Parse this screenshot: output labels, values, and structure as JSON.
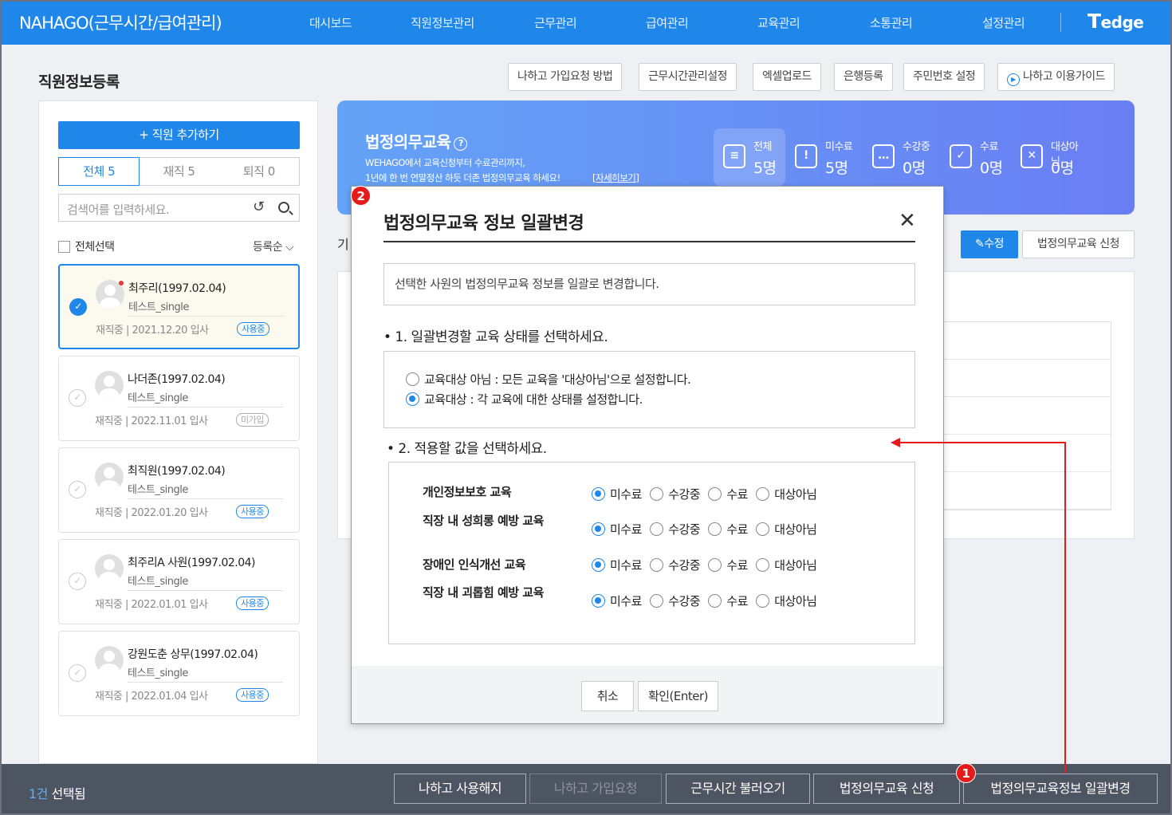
{
  "header": {
    "brand": "NAHAGO(근무시간/급여관리)",
    "nav": [
      "대시보드",
      "직원정보관리",
      "근무관리",
      "급여관리",
      "교육관리",
      "소통관리",
      "설정관리"
    ],
    "logo_t": "T",
    "logo_text": "edge"
  },
  "page": {
    "title": "직원정보등록",
    "toolbar": [
      "나하고 가입요청 방법",
      "근무시간관리설정",
      "엑셀업로드",
      "은행등록",
      "주민번호 설정"
    ],
    "guide": "나하고 이용가이드"
  },
  "left": {
    "add_button": "+ 직원 추가하기",
    "tabs": [
      "전체 5",
      "재직 5",
      "퇴직 0"
    ],
    "search_placeholder": "검색어를 입력하세요.",
    "select_all": "전체선택",
    "sort": "등록순",
    "employees": [
      {
        "name": "최주리(1997.02.04)",
        "team": "테스트_single",
        "info": "재직중 | 2021.12.20 입사",
        "badge": "사용중"
      },
      {
        "name": "나더존(1997.02.04)",
        "team": "테스트_single",
        "info": "재직중 | 2022.11.01 입사",
        "badge": "미가입"
      },
      {
        "name": "최직원(1997.02.04)",
        "team": "테스트_single",
        "info": "재직중 | 2022.01.20 입사",
        "badge": "사용중"
      },
      {
        "name": "최주리A 사원(1997.02.04)",
        "team": "테스트_single",
        "info": "재직중 | 2022.01.01 입사",
        "badge": "사용중"
      },
      {
        "name": "강원도춘 상무(1997.02.04)",
        "team": "테스트_single",
        "info": "재직중 | 2022.01.04 입사",
        "badge": "사용중"
      }
    ]
  },
  "banner": {
    "title": "법정의무교육",
    "desc1": "WEHAGO에서 교육신청부터 수료관리까지,",
    "desc2": "1년에 한 번 연말정산 하듯 더존 법정의무교육 하세요!",
    "more": "[자세히보기]",
    "stats": [
      {
        "label": "전체",
        "value": "5명",
        "icon": "list-icon"
      },
      {
        "label": "미수료",
        "value": "5명",
        "icon": "alert-icon"
      },
      {
        "label": "수강중",
        "value": "0명",
        "icon": "dots-icon"
      },
      {
        "label": "수료",
        "value": "0명",
        "icon": "check-icon"
      },
      {
        "label": "대상아님",
        "value": "0명",
        "icon": "x-icon"
      }
    ]
  },
  "right": {
    "tab": "기",
    "edit": "수정",
    "apply": "법정의무교육 신청"
  },
  "modal": {
    "marker": "2",
    "title": "법정의무교육 정보 일괄변경",
    "notice": "선택한 사원의 법정의무교육 정보를 일괄로 변경합니다.",
    "section1": "• 1. 일괄변경할 교육 상태를 선택하세요.",
    "opt1": "교육대상 아님 : 모든 교육을 '대상아님'으로 설정합니다.",
    "opt2": "교육대상 : 각 교육에 대한 상태를 설정합니다.",
    "section2": "• 2. 적용할 값을 선택하세요.",
    "rows": [
      {
        "label": "개인정보보호 교육"
      },
      {
        "label": "직장 내 성희롱 예방 교육"
      },
      {
        "label": "장애인 인식개선 교육"
      },
      {
        "label": "직장 내 괴롭힘 예방 교육"
      }
    ],
    "choices": [
      "미수료",
      "수강중",
      "수료",
      "대상아님"
    ],
    "cancel": "취소",
    "ok": "확인(Enter)"
  },
  "bottom": {
    "count": "1건",
    "selected": "선택됨",
    "buttons": [
      "나하고 사용해지",
      "나하고 가입요청",
      "근무시간 불러오기",
      "법정의무교육 신청",
      "법정의무교육정보 일괄변경"
    ],
    "marker": "1"
  },
  "colors": {
    "primary": "#1f87ea",
    "marker": "#e51a1a",
    "bottombar": "#4d5462"
  }
}
